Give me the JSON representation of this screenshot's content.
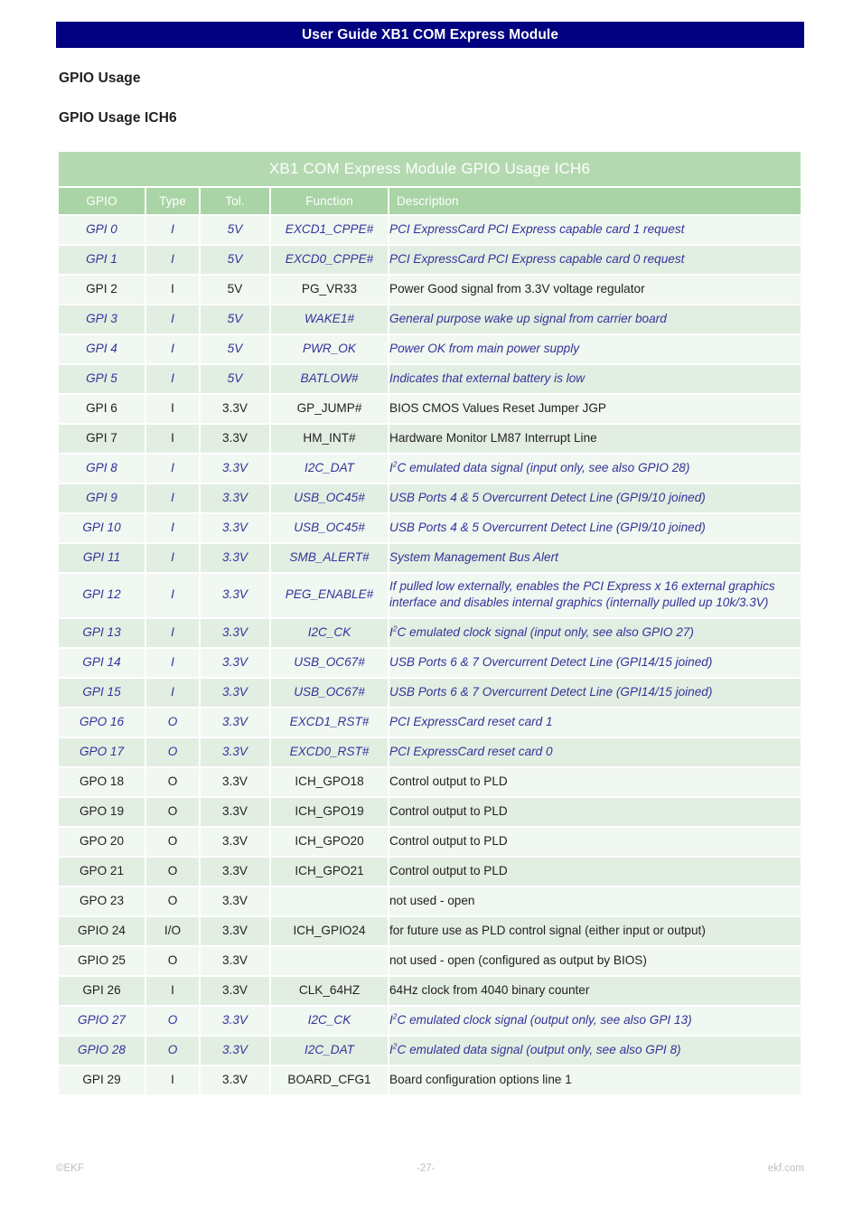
{
  "header": {
    "title": "User Guide XB1 COM Express Module",
    "bar_color": "#000080"
  },
  "headings": {
    "section": "GPIO Usage",
    "subsection": "GPIO Usage ICH6"
  },
  "table": {
    "caption": "XB1 COM Express Module GPIO Usage ICH6",
    "caption_bg": "#b4d9b0",
    "header_bg": "#a9d4a5",
    "row_bg_even": "#f1f7f1",
    "row_bg_odd": "#e3eee3",
    "highlight_color": "#333399",
    "columns": [
      "GPIO",
      "Type",
      "Tol.",
      "Function",
      "Description"
    ],
    "rows": [
      {
        "gpio": "GPI 0",
        "type": "I",
        "tol": "5V",
        "function": "EXCD1_CPPE#",
        "description": "PCI ExpressCard PCI Express capable card 1 request",
        "highlight": true
      },
      {
        "gpio": "GPI 1",
        "type": "I",
        "tol": "5V",
        "function": "EXCD0_CPPE#",
        "description": "PCI ExpressCard PCI Express capable card 0 request",
        "highlight": true
      },
      {
        "gpio": "GPI 2",
        "type": "I",
        "tol": "5V",
        "function": "PG_VR33",
        "description": "Power Good signal from 3.3V voltage regulator",
        "highlight": false
      },
      {
        "gpio": "GPI 3",
        "type": "I",
        "tol": "5V",
        "function": "WAKE1#",
        "description": "General purpose wake up signal from carrier board",
        "highlight": true
      },
      {
        "gpio": "GPI 4",
        "type": "I",
        "tol": "5V",
        "function": "PWR_OK",
        "description": "Power OK from main power supply",
        "highlight": true
      },
      {
        "gpio": "GPI 5",
        "type": "I",
        "tol": "5V",
        "function": "BATLOW#",
        "description": "Indicates that external battery is low",
        "highlight": true
      },
      {
        "gpio": "GPI 6",
        "type": "I",
        "tol": "3.3V",
        "function": "GP_JUMP#",
        "description": "BIOS CMOS Values Reset Jumper JGP",
        "highlight": false
      },
      {
        "gpio": "GPI 7",
        "type": "I",
        "tol": "3.3V",
        "function": "HM_INT#",
        "description": "Hardware Monitor LM87 Interrupt Line",
        "highlight": false
      },
      {
        "gpio": "GPI 8",
        "type": "I",
        "tol": "3.3V",
        "function": "I2C_DAT",
        "description": "I|2|C emulated data signal (input only, see also GPIO 28)",
        "highlight": true
      },
      {
        "gpio": "GPI 9",
        "type": "I",
        "tol": "3.3V",
        "function": "USB_OC45#",
        "description": "USB Ports 4 & 5 Overcurrent Detect Line (GPI9/10 joined)",
        "highlight": true
      },
      {
        "gpio": "GPI 10",
        "type": "I",
        "tol": "3.3V",
        "function": "USB_OC45#",
        "description": "USB Ports 4 & 5 Overcurrent Detect Line (GPI9/10 joined)",
        "highlight": true
      },
      {
        "gpio": "GPI 11",
        "type": "I",
        "tol": "3.3V",
        "function": "SMB_ALERT#",
        "description": "System Management Bus Alert",
        "highlight": true
      },
      {
        "gpio": "GPI 12",
        "type": "I",
        "tol": "3.3V",
        "function": "PEG_ENABLE#",
        "description": "If pulled low externally, enables the PCI Express x 16 external graphics interface and disables internal graphics (internally pulled up 10k/3.3V)",
        "highlight": true
      },
      {
        "gpio": "GPI 13",
        "type": "I",
        "tol": "3.3V",
        "function": "I2C_CK",
        "description": "I|2|C emulated clock signal (input only, see also GPIO 27)",
        "highlight": true
      },
      {
        "gpio": "GPI 14",
        "type": "I",
        "tol": "3.3V",
        "function": "USB_OC67#",
        "description": "USB Ports 6 & 7 Overcurrent Detect Line (GPI14/15 joined)",
        "highlight": true
      },
      {
        "gpio": "GPI 15",
        "type": "I",
        "tol": "3.3V",
        "function": "USB_OC67#",
        "description": "USB Ports 6 & 7 Overcurrent Detect Line (GPI14/15 joined)",
        "highlight": true
      },
      {
        "gpio": "GPO 16",
        "type": "O",
        "tol": "3.3V",
        "function": "EXCD1_RST#",
        "description": "PCI ExpressCard reset card 1",
        "highlight": true
      },
      {
        "gpio": "GPO 17",
        "type": "O",
        "tol": "3.3V",
        "function": "EXCD0_RST#",
        "description": "PCI ExpressCard reset card 0",
        "highlight": true
      },
      {
        "gpio": "GPO 18",
        "type": "O",
        "tol": "3.3V",
        "function": "ICH_GPO18",
        "description": "Control output to PLD",
        "highlight": false
      },
      {
        "gpio": "GPO 19",
        "type": "O",
        "tol": "3.3V",
        "function": "ICH_GPO19",
        "description": "Control output to PLD",
        "highlight": false
      },
      {
        "gpio": "GPO 20",
        "type": "O",
        "tol": "3.3V",
        "function": "ICH_GPO20",
        "description": "Control output to PLD",
        "highlight": false
      },
      {
        "gpio": "GPO 21",
        "type": "O",
        "tol": "3.3V",
        "function": "ICH_GPO21",
        "description": "Control output to PLD",
        "highlight": false
      },
      {
        "gpio": "GPO 23",
        "type": "O",
        "tol": "3.3V",
        "function": "",
        "description": "not used - open",
        "highlight": false
      },
      {
        "gpio": "GPIO 24",
        "type": "I/O",
        "tol": "3.3V",
        "function": "ICH_GPIO24",
        "description": "for future use as PLD control signal (either input or output)",
        "highlight": false
      },
      {
        "gpio": "GPIO 25",
        "type": "O",
        "tol": "3.3V",
        "function": "",
        "description": "not used - open (configured as output by BIOS)",
        "highlight": false
      },
      {
        "gpio": "GPI 26",
        "type": "I",
        "tol": "3.3V",
        "function": "CLK_64HZ",
        "description": "64Hz clock from 4040 binary counter",
        "highlight": false
      },
      {
        "gpio": "GPIO 27",
        "type": "O",
        "tol": "3.3V",
        "function": "I2C_CK",
        "description": "I|2|C emulated clock signal (output only, see also GPI 13)",
        "highlight": true
      },
      {
        "gpio": "GPIO 28",
        "type": "O",
        "tol": "3.3V",
        "function": "I2C_DAT",
        "description": "I|2|C emulated data signal (output only, see also GPI 8)",
        "highlight": true
      },
      {
        "gpio": "GPI 29",
        "type": "I",
        "tol": "3.3V",
        "function": "BOARD_CFG1",
        "description": "Board configuration options line 1",
        "highlight": false
      }
    ]
  },
  "footer": {
    "copyright": "©EKF",
    "page": "-27-",
    "site": "ekf.com"
  }
}
